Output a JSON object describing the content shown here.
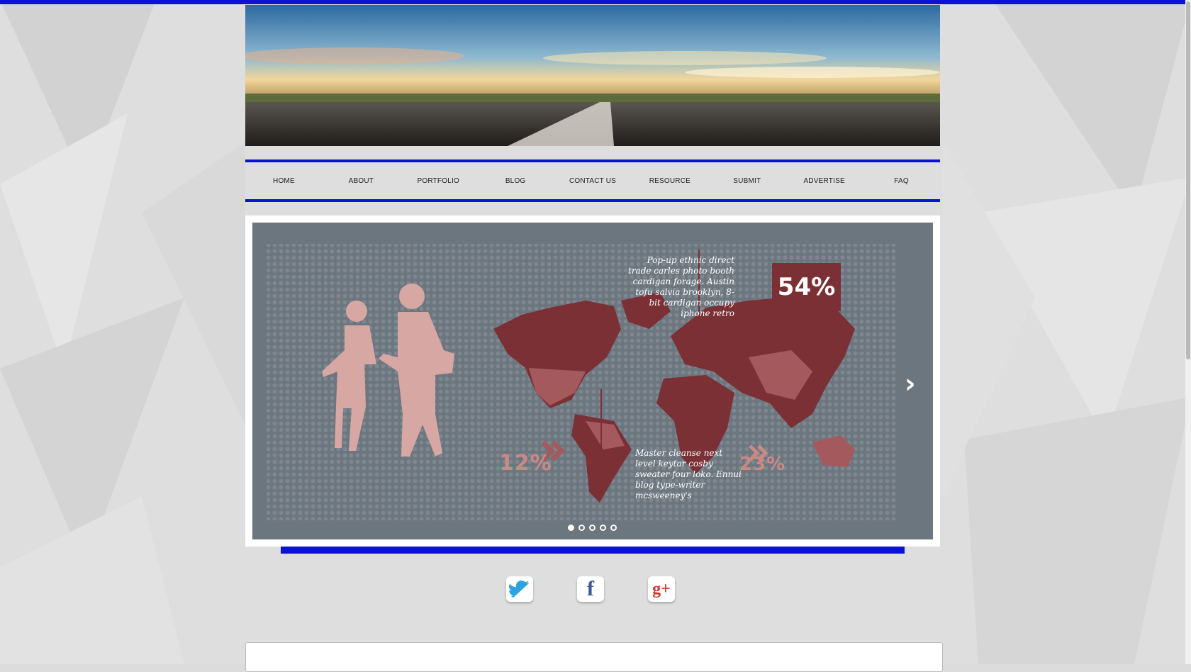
{
  "nav": {
    "items": [
      "HOME",
      "ABOUT",
      "PORTFOLIO",
      "BLOG",
      "CONTACT US",
      "RESOURCE",
      "SUBMIT",
      "ADVERTISE",
      "FAQ"
    ]
  },
  "slider": {
    "text_top": "Pop-up ethnic direct trade carles photo booth cardigan forage. Austin tofu salvia brooklyn, 8-bit cardigan occupy iphone retro",
    "text_bottom": "Master cleanse next level keytar cosby sweater four loko. Ennui blog type-writer  mcsweeney's",
    "badge_value": "54%",
    "stat_left": "12%",
    "stat_right": "23%",
    "next_icon": "chevron-right-icon",
    "dot_count": 5,
    "active_dot": 1
  },
  "social": {
    "icons": [
      "twitter-icon",
      "facebook-icon",
      "google-plus-icon"
    ],
    "facebook_glyph": "f",
    "google_glyph": "g+"
  },
  "colors": {
    "accent": "#0a12d6",
    "slide_bg": "#6c767f",
    "map_dark": "#7b3036",
    "map_light": "#a45a5c",
    "figure": "#d7a7a3"
  }
}
